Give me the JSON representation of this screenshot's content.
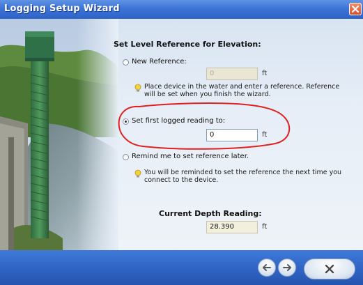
{
  "window": {
    "title": "Logging Setup Wizard"
  },
  "section": {
    "heading": "Set Level Reference for Elevation:"
  },
  "options": {
    "new_reference": {
      "label": "New Reference:",
      "value": "0",
      "unit": "ft",
      "selected": false
    },
    "new_reference_hint": "Place device in the water and enter a reference. Reference will be set when you finish the wizard.",
    "first_reading": {
      "label": "Set first logged reading to:",
      "value": "0",
      "unit": "ft",
      "selected": true
    },
    "remind": {
      "label": "Remind me to set reference later.",
      "selected": false
    },
    "remind_hint": "You will be reminded to set the reference the next time you connect to the device."
  },
  "depth": {
    "label": "Current Depth Reading:",
    "value": "28.390",
    "unit": "ft"
  },
  "footer": {
    "back_icon": "arrow-left-icon",
    "next_icon": "arrow-right-icon",
    "finish_icon": "x-icon"
  },
  "colors": {
    "titlebar": "#3d74d6",
    "close": "#d6532e",
    "annotation": "#e02020",
    "panel": "#e7eef7"
  }
}
